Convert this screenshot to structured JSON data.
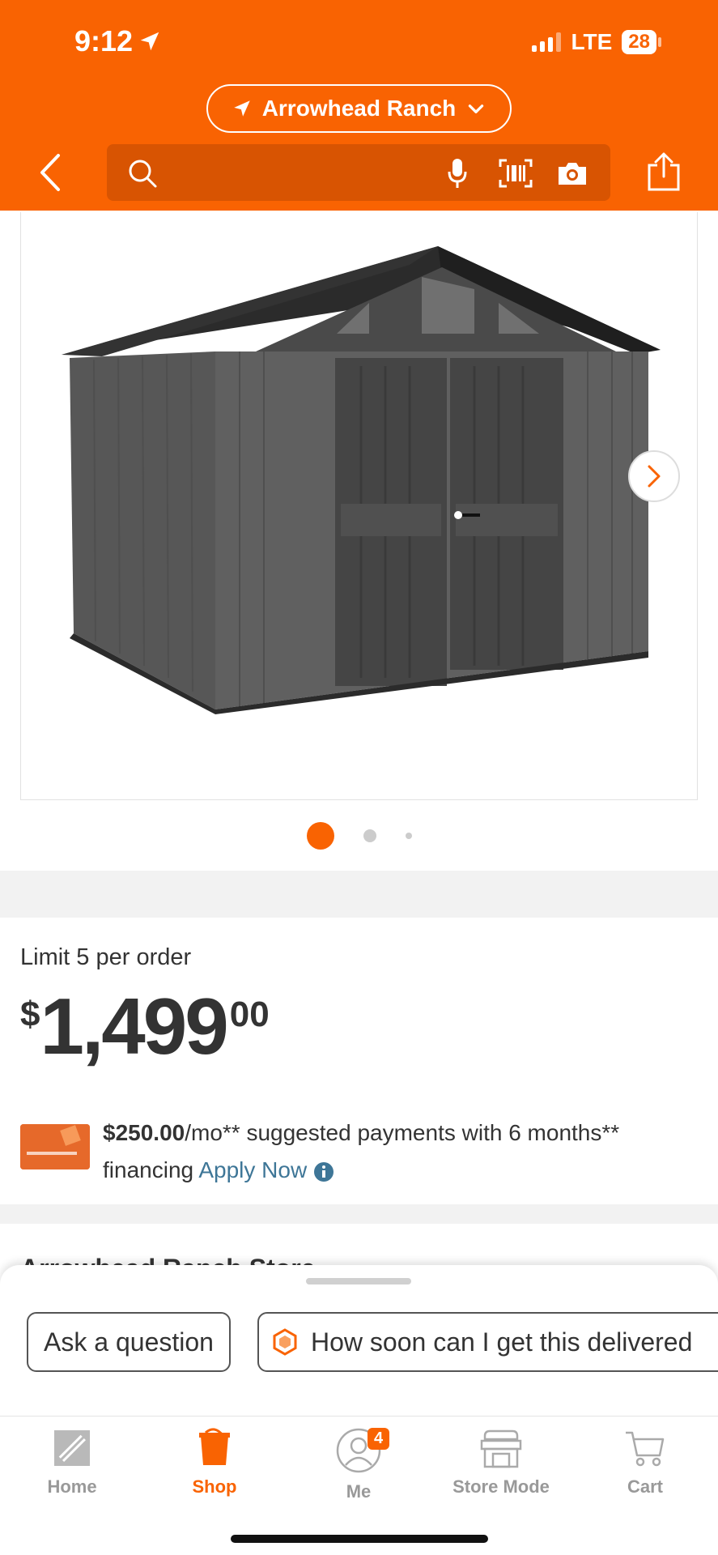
{
  "status_bar": {
    "time": "9:12",
    "network": "LTE",
    "battery": "28"
  },
  "header": {
    "location": "Arrowhead Ranch",
    "search": {
      "placeholder": ""
    },
    "brand_color": "#f96302"
  },
  "gallery": {
    "page_count": 3,
    "current_page": 1
  },
  "product": {
    "limit_text": "Limit 5 per order",
    "price": {
      "currency": "$",
      "whole": "1,499",
      "cents": "00"
    },
    "financing": {
      "amount": "$250.00",
      "text_1": "/mo** suggested payments with 6 months**",
      "text_2": "financing",
      "apply_link": "Apply Now"
    },
    "store_line": "Arrowhead Ranch Store"
  },
  "chat_sheet": {
    "chips": [
      {
        "label": "Ask a question"
      },
      {
        "label": "How soon can I get this delivered"
      }
    ]
  },
  "tab_bar": {
    "tabs": [
      {
        "label": "Home",
        "icon": "home-depot-logo-icon",
        "active": false
      },
      {
        "label": "Shop",
        "icon": "shop-bucket-icon",
        "active": true
      },
      {
        "label": "Me",
        "icon": "user-icon",
        "active": false,
        "badge": "4"
      },
      {
        "label": "Store Mode",
        "icon": "store-icon",
        "active": false
      },
      {
        "label": "Cart",
        "icon": "cart-icon",
        "active": false
      }
    ]
  }
}
